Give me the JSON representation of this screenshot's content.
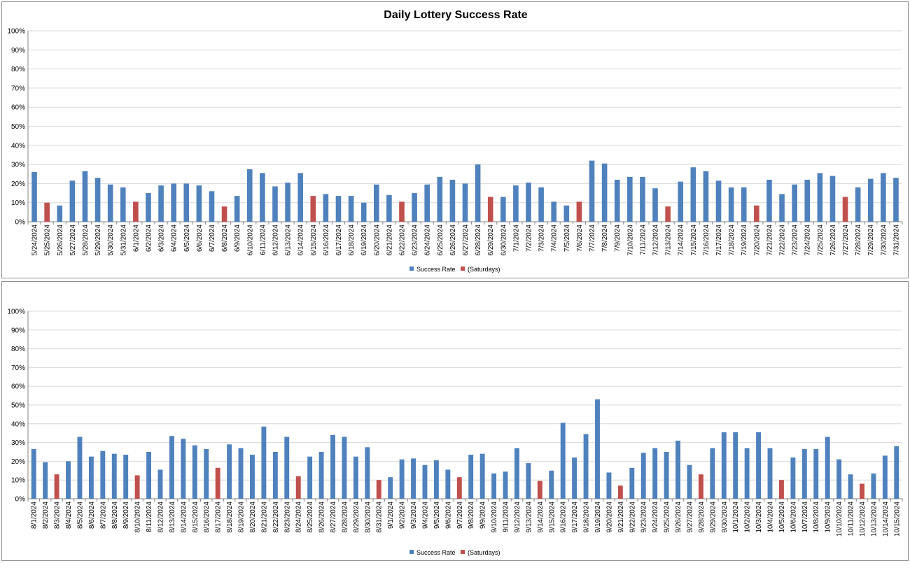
{
  "chart_data": [
    {
      "type": "bar",
      "title": "Daily Lottery Success Rate",
      "xlabel": "",
      "ylabel": "",
      "ylim": [
        0,
        100
      ],
      "yticks": [
        "0%",
        "10%",
        "20%",
        "30%",
        "40%",
        "50%",
        "60%",
        "70%",
        "80%",
        "90%",
        "100%"
      ],
      "grid": true,
      "legend_position": "bottom",
      "colors": {
        "Success Rate": "#4f81bd",
        "(Saturdays)": "#c0504d"
      },
      "categories": [
        "5/24/2024",
        "5/25/2024",
        "5/26/2024",
        "5/27/2024",
        "5/28/2024",
        "5/29/2024",
        "5/30/2024",
        "5/31/2024",
        "6/1/2024",
        "6/2/2024",
        "6/3/2024",
        "6/4/2024",
        "6/5/2024",
        "6/6/2024",
        "6/7/2024",
        "6/8/2024",
        "6/9/2024",
        "6/10/2024",
        "6/11/2024",
        "6/12/2024",
        "6/13/2024",
        "6/14/2024",
        "6/15/2024",
        "6/16/2024",
        "6/17/2024",
        "6/18/2024",
        "6/19/2024",
        "6/20/2024",
        "6/21/2024",
        "6/22/2024",
        "6/23/2024",
        "6/24/2024",
        "6/25/2024",
        "6/26/2024",
        "6/27/2024",
        "6/28/2024",
        "6/29/2024",
        "6/30/2024",
        "7/1/2024",
        "7/2/2024",
        "7/3/2024",
        "7/4/2024",
        "7/5/2024",
        "7/6/2024",
        "7/7/2024",
        "7/8/2024",
        "7/9/2024",
        "7/10/2024",
        "7/11/2024",
        "7/12/2024",
        "7/13/2024",
        "7/14/2024",
        "7/15/2024",
        "7/16/2024",
        "7/17/2024",
        "7/18/2024",
        "7/19/2024",
        "7/20/2024",
        "7/21/2024",
        "7/22/2024",
        "7/23/2024",
        "7/24/2024",
        "7/25/2024",
        "7/26/2024",
        "7/27/2024",
        "7/28/2024",
        "7/29/2024",
        "7/30/2024",
        "7/31/2024"
      ],
      "series": [
        {
          "name": "Success Rate",
          "values": [
            26,
            null,
            8.5,
            21.5,
            26.5,
            23,
            19.5,
            18,
            null,
            15,
            19,
            20,
            20,
            19,
            16,
            null,
            13.5,
            27.5,
            25.5,
            18.5,
            20.5,
            25.5,
            null,
            14.5,
            13.5,
            13.5,
            10,
            19.5,
            14,
            null,
            15,
            19.5,
            23.5,
            22,
            20,
            30,
            null,
            13,
            19,
            20.5,
            18,
            10.5,
            8.5,
            null,
            32,
            30.5,
            22,
            23.5,
            23.5,
            17.5,
            null,
            21,
            28.5,
            26.5,
            21.5,
            18,
            18,
            null,
            22,
            14.5,
            19.5,
            22,
            25.5,
            24,
            null,
            18,
            22.5,
            25.5,
            23
          ]
        },
        {
          "name": "(Saturdays)",
          "values": [
            null,
            10,
            null,
            null,
            null,
            null,
            null,
            null,
            10.5,
            null,
            null,
            null,
            null,
            null,
            null,
            8,
            null,
            null,
            null,
            null,
            null,
            null,
            13.5,
            null,
            null,
            null,
            null,
            null,
            null,
            10.5,
            null,
            null,
            null,
            null,
            null,
            null,
            13,
            null,
            null,
            null,
            null,
            null,
            null,
            10.5,
            null,
            null,
            null,
            null,
            null,
            null,
            8,
            null,
            null,
            null,
            null,
            null,
            null,
            8.5,
            null,
            null,
            null,
            null,
            null,
            null,
            13,
            null,
            null,
            null,
            null
          ]
        }
      ]
    },
    {
      "type": "bar",
      "title": "",
      "xlabel": "",
      "ylabel": "",
      "ylim": [
        0,
        100
      ],
      "yticks": [
        "0%",
        "10%",
        "20%",
        "30%",
        "40%",
        "50%",
        "60%",
        "70%",
        "80%",
        "90%",
        "100%"
      ],
      "grid": true,
      "legend_position": "bottom",
      "colors": {
        "Success Rate": "#4f81bd",
        "(Saturdays)": "#c0504d"
      },
      "categories": [
        "8/1/2024",
        "8/2/2024",
        "8/3/2024",
        "8/4/2024",
        "8/5/2024",
        "8/6/2024",
        "8/7/2024",
        "8/8/2024",
        "8/9/2024",
        "8/10/2024",
        "8/11/2024",
        "8/12/2024",
        "8/13/2024",
        "8/14/2024",
        "8/15/2024",
        "8/16/2024",
        "8/17/2024",
        "8/18/2024",
        "8/19/2024",
        "8/20/2024",
        "8/21/2024",
        "8/22/2024",
        "8/23/2024",
        "8/24/2024",
        "8/25/2024",
        "8/26/2024",
        "8/27/2024",
        "8/28/2024",
        "8/29/2024",
        "8/30/2024",
        "8/31/2024",
        "9/1/2024",
        "9/2/2024",
        "9/3/2024",
        "9/4/2024",
        "9/5/2024",
        "9/6/2024",
        "9/7/2024",
        "9/8/2024",
        "9/9/2024",
        "9/10/2024",
        "9/11/2024",
        "9/12/2024",
        "9/13/2024",
        "9/14/2024",
        "9/15/2024",
        "9/16/2024",
        "9/17/2024",
        "9/18/2024",
        "9/19/2024",
        "9/20/2024",
        "9/21/2024",
        "9/22/2024",
        "9/23/2024",
        "9/24/2024",
        "9/25/2024",
        "9/26/2024",
        "9/27/2024",
        "9/28/2024",
        "9/29/2024",
        "9/30/2024",
        "10/1/2024",
        "10/2/2024",
        "10/3/2024",
        "10/4/2024",
        "10/5/2024",
        "10/6/2024",
        "10/7/2024",
        "10/8/2024",
        "10/9/2024",
        "10/10/2024",
        "10/11/2024",
        "10/12/2024",
        "10/13/2024",
        "10/14/2024",
        "10/15/2024"
      ],
      "series": [
        {
          "name": "Success Rate",
          "values": [
            26.5,
            19.5,
            null,
            20,
            33,
            22.5,
            25.5,
            24,
            23.5,
            null,
            25,
            15.5,
            33.5,
            32,
            28.5,
            26.5,
            null,
            29,
            27,
            23.5,
            38.5,
            25,
            33,
            null,
            22.5,
            25,
            34,
            33,
            22.5,
            27.5,
            null,
            11.5,
            21,
            21.5,
            18,
            20.5,
            15.5,
            null,
            23.5,
            24,
            13.5,
            14.5,
            27,
            19,
            null,
            15,
            40.5,
            22,
            34.5,
            53,
            14,
            null,
            16.5,
            24.5,
            27,
            25,
            31,
            18,
            null,
            27,
            35.5,
            35.5,
            27,
            35.5,
            27,
            null,
            22,
            26.5,
            26.5,
            33,
            21,
            13,
            null,
            13.5,
            23,
            28
          ]
        },
        {
          "name": "(Saturdays)",
          "values": [
            null,
            null,
            13,
            null,
            null,
            null,
            null,
            null,
            null,
            12.5,
            null,
            null,
            null,
            null,
            null,
            null,
            16.5,
            null,
            null,
            null,
            null,
            null,
            null,
            12,
            null,
            null,
            null,
            null,
            null,
            null,
            10,
            null,
            null,
            null,
            null,
            null,
            null,
            11.5,
            null,
            null,
            null,
            null,
            null,
            null,
            9.5,
            null,
            null,
            null,
            null,
            null,
            null,
            7,
            null,
            null,
            null,
            null,
            null,
            null,
            13,
            null,
            null,
            null,
            null,
            null,
            null,
            10,
            null,
            null,
            null,
            null,
            null,
            null,
            8,
            null,
            null,
            null
          ]
        }
      ]
    }
  ]
}
